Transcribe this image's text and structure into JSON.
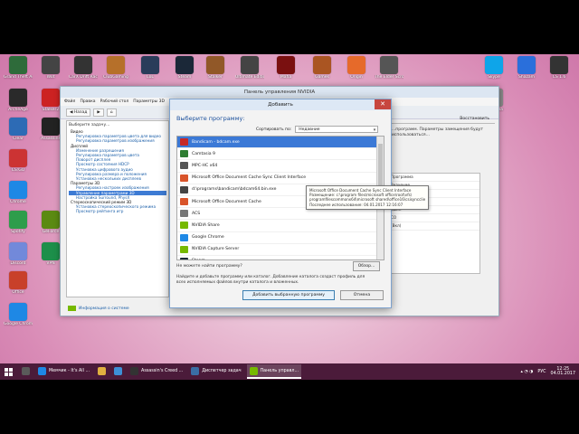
{
  "desktop_icons": [
    {
      "label": "Grand Theft Auto V",
      "color": "#2e6b3a"
    },
    {
      "label": "Wot",
      "color": "#444"
    },
    {
      "label": "CarX Drift Racing",
      "color": "#333"
    },
    {
      "label": "ClubGaming",
      "color": "#b6702a"
    },
    {
      "label": "LoL",
      "color": "#2a3c5a"
    },
    {
      "label": "Steam",
      "color": "#1b2838"
    },
    {
      "label": "Stalker",
      "color": "#915828"
    },
    {
      "label": "Ultimate Edition",
      "color": "#444"
    },
    {
      "label": "Mafia",
      "color": "#7a1010"
    },
    {
      "label": "Games",
      "color": "#aa5522"
    },
    {
      "label": "Origin",
      "color": "#e66a2a"
    },
    {
      "label": "The Elder Scrolls V",
      "color": "#555"
    },
    {
      "label": "ArcheAge",
      "color": "#2a2a2a"
    },
    {
      "label": "Stalker2",
      "color": "#cc2222"
    },
    {
      "label": "Clear",
      "color": "#2d6bb5"
    },
    {
      "label": "Assassins",
      "color": "#222"
    },
    {
      "label": "CS:GO",
      "color": "#cc3333"
    },
    {
      "label": "Chrome",
      "color": "#1e88e5"
    },
    {
      "label": "Spotify",
      "color": "#2e9d4b"
    },
    {
      "label": "GeForce",
      "color": "#5b8a12"
    },
    {
      "label": "Discord",
      "color": "#7289da"
    },
    {
      "label": "VPN",
      "color": "#1d8f4a"
    },
    {
      "label": "Office",
      "color": "#c8402a"
    },
    {
      "label": "Google Chrome",
      "color": "#1e88e5"
    },
    {
      "label": "Skype",
      "color": "#0ea5e9"
    },
    {
      "label": "Shazam",
      "color": "#2a6fdb"
    },
    {
      "label": "CS 1.6",
      "color": "#333"
    },
    {
      "label": "Корзина",
      "color": "#888"
    }
  ],
  "nvidia": {
    "window_title": "Панель управления NVIDIA",
    "menu": [
      "Файл",
      "Правка",
      "Рабочий стол",
      "Параметры 3D",
      "Справка"
    ],
    "toolbar_back": "Назад",
    "task_caption": "Выберите задачу...",
    "tree": [
      {
        "text": "Видео",
        "level": 0
      },
      {
        "text": "Регулировка параметров цвета для видео",
        "level": 1
      },
      {
        "text": "Регулировка параметров изображения",
        "level": 1
      },
      {
        "text": "Дисплей",
        "level": 0
      },
      {
        "text": "Изменение разрешения",
        "level": 1
      },
      {
        "text": "Регулировка параметров цвета",
        "level": 1
      },
      {
        "text": "Поворот дисплея",
        "level": 1
      },
      {
        "text": "Просмотр состояния HDCP",
        "level": 1
      },
      {
        "text": "Установка цифрового аудио",
        "level": 1
      },
      {
        "text": "Регулировка размера и положения",
        "level": 1
      },
      {
        "text": "Установка нескольких дисплеев",
        "level": 1
      },
      {
        "text": "Параметры 3D",
        "level": 0
      },
      {
        "text": "Регулировка настроек изображения",
        "level": 1
      },
      {
        "text": "Управление параметрами 3D",
        "level": 1,
        "selected": true
      },
      {
        "text": "Настройка Surround, PhysX",
        "level": 1
      },
      {
        "text": "Стереоскопический режим 3D",
        "level": 0
      },
      {
        "text": "Установка стереоскопического режима",
        "level": 1
      },
      {
        "text": "Просмотр рейтинга игр",
        "level": 1
      }
    ],
    "restore_label": "Восстановить",
    "right_desc": "...программ. Параметры замещения будут использоваться...",
    "right_list": [
      "Программа",
      "Значение",
      "(Вкл)",
      "Выкл",
      "Выкл",
      "CO",
      "(Вкл)"
    ],
    "apply_hint": "...чтобы добавить",
    "system_info": "Информация о системе"
  },
  "dialog": {
    "title": "Добавить",
    "heading": "Выберите программу:",
    "sort_label": "Сортировать по:",
    "sort_value": "Недавние",
    "programs": [
      {
        "name": "Bandicam - bdcam.exe",
        "color": "#c62828",
        "selected": true
      },
      {
        "name": "Camtasia 9",
        "color": "#2e7d32"
      },
      {
        "name": "MPC-HC x64",
        "color": "#555"
      },
      {
        "name": "Microsoft Office Document Cache Sync Client Interface",
        "color": "#d9542a"
      },
      {
        "name": "d:\\programs\\bandicam\\bdcam64.bin.exe",
        "color": "#444"
      },
      {
        "name": "Microsoft Office Document Cache",
        "color": "#d9542a"
      },
      {
        "name": "ACS",
        "color": "#777"
      },
      {
        "name": "NVIDIA Share",
        "color": "#76b900"
      },
      {
        "name": "Google Chrome",
        "color": "#1e88e5"
      },
      {
        "name": "NVIDIA Capture Server",
        "color": "#76b900"
      },
      {
        "name": "Steam",
        "color": "#1b2838"
      }
    ],
    "not_found": "Не можете найти программу?",
    "browse_label": "Обзор...",
    "hint": "Найдите и добавьте программу или каталог. Добавление каталога создаст профиль для всех исполняемых файлов внутри каталога и вложенных.",
    "add_button": "Добавить выбранную программу",
    "cancel_button": "Отмена"
  },
  "tooltip": [
    "Microsoft Office Document Cache Sync Client Interface",
    "Размещение: c:\\program files\\microsoft office\\root\\vfs\\",
    "programfilescommonx64\\microsoft shared\\office16\\csisyncclient.exe",
    "Последнее использование: 04.01.2017 12:16:07"
  ],
  "taskbar": {
    "tasks": [
      {
        "label": "",
        "color": "#5a5a5a"
      },
      {
        "label": "Мемчик - It's All ...",
        "color": "#1e88e5"
      },
      {
        "label": "",
        "color": "#e0b040"
      },
      {
        "label": "",
        "color": "#3d8fd6"
      },
      {
        "label": "Assassin's Creed ...",
        "color": "#333"
      },
      {
        "label": "Диспетчер задач",
        "color": "#3a6ea5"
      },
      {
        "label": "Панель управл...",
        "color": "#76b900",
        "active": true
      }
    ],
    "lang": "РУС",
    "time": "12:25",
    "date": "04.01.2017"
  }
}
